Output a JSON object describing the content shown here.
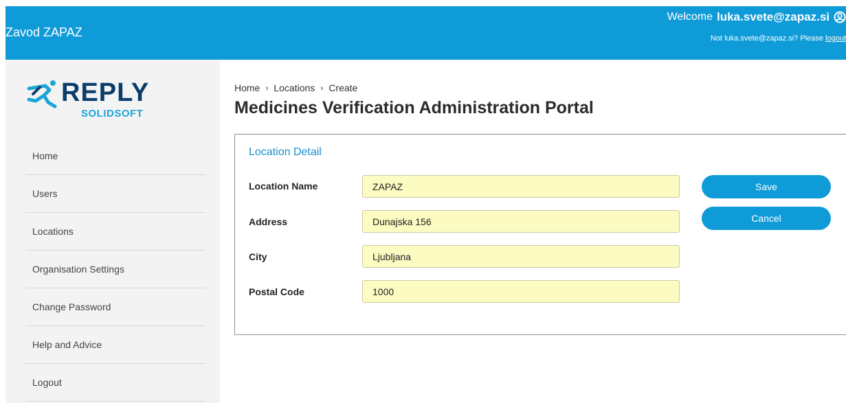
{
  "header": {
    "org_name": "Zavod ZAPAZ",
    "welcome_prefix": "Welcome",
    "user_email": "luka.svete@zapaz.si",
    "not_user_text": "Not luka.svete@zapaz.si? Please",
    "logout_link": "logout",
    "user_icon": "user-circle-icon"
  },
  "logo": {
    "brand": "REPLY",
    "sub": "SOLIDSOFT"
  },
  "sidebar": {
    "items": [
      {
        "label": "Home"
      },
      {
        "label": "Users"
      },
      {
        "label": "Locations"
      },
      {
        "label": "Organisation Settings"
      },
      {
        "label": "Change Password"
      },
      {
        "label": "Help and Advice"
      },
      {
        "label": "Logout"
      }
    ]
  },
  "breadcrumb": {
    "items": [
      "Home",
      "Locations",
      "Create"
    ],
    "separator": "›"
  },
  "page": {
    "title": "Medicines Verification Administration Portal"
  },
  "form": {
    "panel_title": "Location Detail",
    "fields": [
      {
        "label": "Location Name",
        "value": "ZAPAZ"
      },
      {
        "label": "Address",
        "value": "Dunajska 156"
      },
      {
        "label": "City",
        "value": "Ljubljana"
      },
      {
        "label": "Postal Code",
        "value": "1000"
      }
    ],
    "save_label": "Save",
    "cancel_label": "Cancel"
  },
  "colors": {
    "header_bg": "#0e9bd8",
    "sidebar_bg": "#f3f3f3",
    "input_bg": "#fbfbc2",
    "brand_dark": "#0b3d6b",
    "brand_light": "#1ca5d9"
  }
}
